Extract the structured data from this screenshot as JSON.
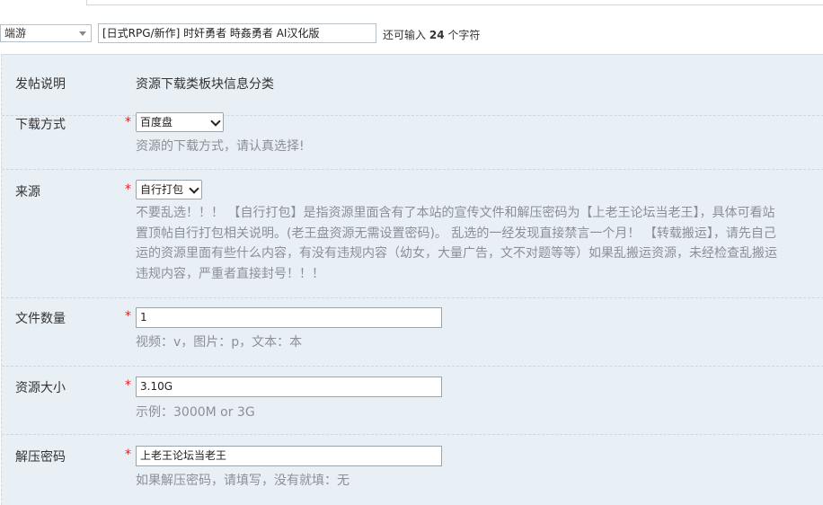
{
  "title_row": {
    "type_select": "端游",
    "title_value": "[日式RPG/新作] 时奸勇者 時姦勇者 AI汉化版",
    "counter_prefix": "还可输入",
    "counter_value": "24",
    "counter_suffix": "个字符"
  },
  "form": {
    "post_info": {
      "label": "发帖说明",
      "value": "资源下载类板块信息分类"
    },
    "download": {
      "label": "下载方式",
      "required": "*",
      "selected": "百度盘",
      "hint": "资源的下载方式，请认真选择!"
    },
    "source": {
      "label": "来源",
      "required": "*",
      "selected": "自行打包",
      "hint_lines": [
        "不要乱选！！！ 【自行打包】是指资源里面含有了本站的宣传文件和解压密码为【上老王论坛当老王】，具体可看站",
        "置顶帖自行打包相关说明。(老王盘资源无需设置密码)。 乱选的一经发现直接禁言一个月！ 【转载搬运】，请先自己",
        "运的资源里面有些什么内容，有没有违规内容（幼女，大量广告，文不对题等等）如果乱搬运资源，未经检查乱搬运",
        "违规内容，严重者直接封号！！！"
      ]
    },
    "file_count": {
      "label": "文件数量",
      "required": "*",
      "value": "1",
      "hint": "视频：v，图片：p，文本：本"
    },
    "size": {
      "label": "资源大小",
      "required": "*",
      "value": "3.10G",
      "hint": "示例：3000M or 3G"
    },
    "password": {
      "label": "解压密码",
      "required": "*",
      "value": "上老王论坛当老王",
      "hint": "如果解压密码，请填写，没有就填：无"
    }
  }
}
